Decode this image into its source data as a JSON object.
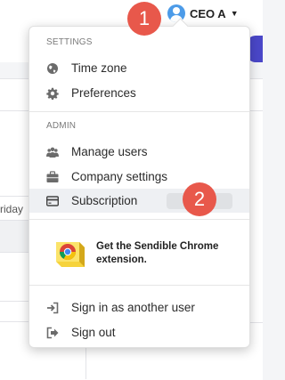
{
  "header": {
    "user_name": "CEO A"
  },
  "badges": {
    "step1": "1",
    "step2": "2"
  },
  "background": {
    "day_fragment": "riday"
  },
  "menu": {
    "settings_title": "SETTINGS",
    "settings_items": [
      {
        "label": "Time zone",
        "icon": "globe-icon"
      },
      {
        "label": "Preferences",
        "icon": "gear-icon"
      }
    ],
    "admin_title": "ADMIN",
    "admin_items": [
      {
        "label": "Manage users",
        "icon": "users-icon"
      },
      {
        "label": "Company settings",
        "icon": "briefcase-icon"
      },
      {
        "label": "Subscription",
        "icon": "credit-card-icon"
      }
    ],
    "chrome_promo": "Get the Sendible Chrome extension.",
    "account_items": [
      {
        "label": "Sign in as another user",
        "icon": "sign-in-icon"
      },
      {
        "label": "Sign out",
        "icon": "sign-out-icon"
      }
    ]
  },
  "colors": {
    "badge": "#e8584b",
    "avatar": "#4c9be8",
    "accent_purple": "#4a47c8"
  }
}
